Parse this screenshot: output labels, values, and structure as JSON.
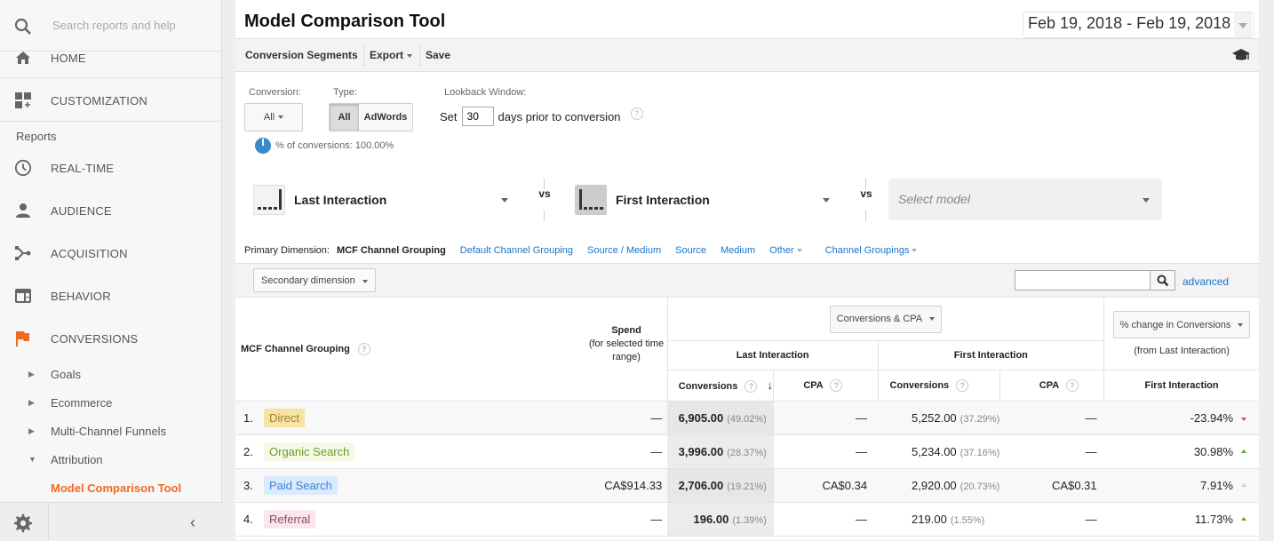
{
  "sidebar": {
    "search_placeholder": "Search reports and help",
    "items": [
      {
        "label": "HOME",
        "icon": "home-icon"
      },
      {
        "label": "CUSTOMIZATION",
        "icon": "customization-icon"
      }
    ],
    "section_label": "Reports",
    "reports": [
      {
        "label": "REAL-TIME",
        "icon": "clock-icon"
      },
      {
        "label": "AUDIENCE",
        "icon": "person-icon"
      },
      {
        "label": "ACQUISITION",
        "icon": "acquisition-icon"
      },
      {
        "label": "BEHAVIOR",
        "icon": "behavior-icon"
      },
      {
        "label": "CONVERSIONS",
        "icon": "flag-icon"
      }
    ],
    "sub_items": [
      {
        "label": "Goals",
        "expanded": false
      },
      {
        "label": "Ecommerce",
        "expanded": false
      },
      {
        "label": "Multi-Channel Funnels",
        "expanded": false
      },
      {
        "label": "Attribution",
        "expanded": true
      },
      {
        "label": "Model Comparison Tool",
        "active": true
      }
    ],
    "accent_color": "#f16a22"
  },
  "header": {
    "title": "Model Comparison Tool",
    "date_range": "Feb 19, 2018 - Feb 19, 2018"
  },
  "toolbar": {
    "conversion_segments": "Conversion Segments",
    "export": "Export",
    "save": "Save"
  },
  "filters": {
    "conversion_label": "Conversion:",
    "conversion_value": "All",
    "type_label": "Type:",
    "type_options": [
      "All",
      "AdWords"
    ],
    "type_selected": "All",
    "lookback_label": "Lookback Window:",
    "lookback_prefix": "Set",
    "lookback_value": "30",
    "lookback_suffix": "days prior to conversion",
    "pct_conversions": "% of conversions: 100.00%"
  },
  "models": {
    "model1": "Last Interaction",
    "model2": "First Interaction",
    "model3_placeholder": "Select model",
    "vs": "vs"
  },
  "dimension": {
    "label": "Primary Dimension:",
    "current": "MCF Channel Grouping",
    "links": [
      "Default Channel Grouping",
      "Source / Medium",
      "Source",
      "Medium"
    ],
    "other": "Other",
    "channel_groupings": "Channel Groupings",
    "secondary": "Secondary dimension",
    "advanced": "advanced"
  },
  "table": {
    "dim_header": "MCF Channel Grouping",
    "spend_header": "Spend",
    "spend_sub": "(for selected time range)",
    "metric_selector": "Conversions & CPA",
    "change_selector": "% change in Conversions",
    "change_sub": "(from Last Interaction)",
    "group1": "Last Interaction",
    "group2": "First Interaction",
    "change_col": "First Interaction",
    "col_conversions": "Conversions",
    "col_cpa": "CPA",
    "rows": [
      {
        "idx": "1.",
        "channel": "Direct",
        "bg": "#f6e3a6",
        "fg": "#a8841f",
        "spend": "—",
        "li_conv": "6,905.00",
        "li_pct": "(49.02%)",
        "li_cpa": "—",
        "fi_conv": "5,252.00",
        "fi_pct": "(37.29%)",
        "fi_cpa": "—",
        "change": "-23.94%",
        "dir": "down",
        "color": "#e04a3f"
      },
      {
        "idx": "2.",
        "channel": "Organic Search",
        "bg": "#f5fae6",
        "fg": "#6f9a2d",
        "spend": "—",
        "li_conv": "3,996.00",
        "li_pct": "(28.37%)",
        "li_cpa": "—",
        "fi_conv": "5,234.00",
        "fi_pct": "(37.16%)",
        "fi_cpa": "—",
        "change": "30.98%",
        "dir": "up",
        "color": "#5aa532"
      },
      {
        "idx": "3.",
        "channel": "Paid Search",
        "bg": "#dbeafc",
        "fg": "#3b82d9",
        "spend": "CA$914.33",
        "li_conv": "2,706.00",
        "li_pct": "(19.21%)",
        "li_cpa": "CA$0.34",
        "fi_conv": "2,920.00",
        "fi_pct": "(20.73%)",
        "fi_cpa": "CA$0.31",
        "change": "7.91%",
        "dir": "up",
        "color": "#cccccc"
      },
      {
        "idx": "4.",
        "channel": "Referral",
        "bg": "#fbe6ee",
        "fg": "#8a4b62",
        "spend": "—",
        "li_conv": "196.00",
        "li_pct": "(1.39%)",
        "li_cpa": "—",
        "fi_conv": "219.00",
        "fi_pct": "(1.55%)",
        "fi_cpa": "—",
        "change": "11.73%",
        "dir": "up",
        "color": "#5aa532"
      }
    ]
  }
}
